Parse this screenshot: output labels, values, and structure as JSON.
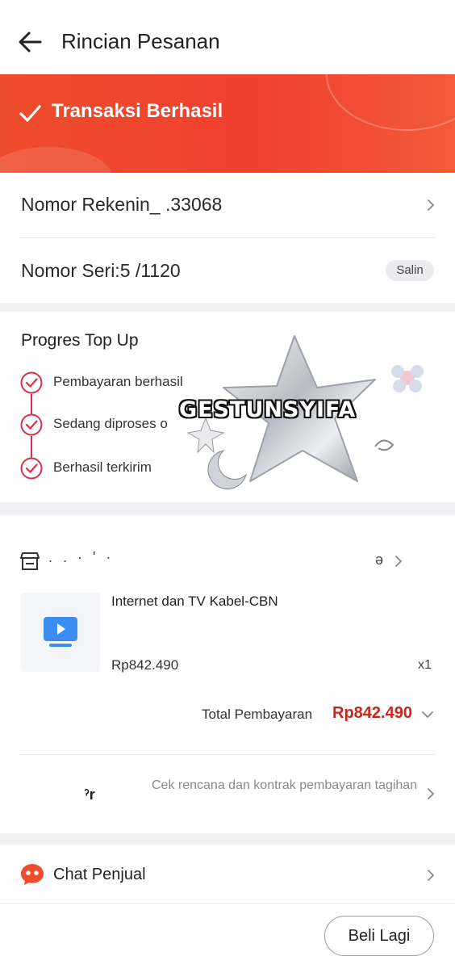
{
  "header": {
    "title": "Rincian Pesanan"
  },
  "banner": {
    "status": "Transaksi Berhasil"
  },
  "account": {
    "label": "Nomor Rekenin_ .33068"
  },
  "serial": {
    "label": "Nomor Seri:5 /1120",
    "copy_label": "Salin"
  },
  "progress": {
    "title": "Progres Top Up",
    "steps": [
      {
        "label": "Pembayaran berhasil"
      },
      {
        "label": "Sedang diproses o"
      },
      {
        "label": "Berhasil terkirim"
      }
    ]
  },
  "sticker": {
    "text": "GESTUNSYIFA"
  },
  "store": {
    "name": ". . · ' ·",
    "suffix": "ə"
  },
  "product": {
    "name": "Internet dan TV Kabel-CBN",
    "price": "Rp842.490",
    "quantity": "x1"
  },
  "total": {
    "label": "Total Pembayaran",
    "value": "Rp842.490"
  },
  "plan": {
    "logo_text": "ˀr",
    "text": "Cek rencana dan kontrak pembayaran tagihan"
  },
  "chat": {
    "label": "Chat Penjual"
  },
  "footer": {
    "buy_again_label": "Beli Lagi"
  },
  "colors": {
    "accent": "#ee4d2d",
    "price": "#c8271e",
    "step": "#d8304a"
  },
  "icons": [
    "arrow-left-icon",
    "check-icon",
    "chevron-right-icon",
    "check-circle-icon",
    "store-icon",
    "tv-play-icon",
    "chevron-down-icon",
    "chat-bubble-icon"
  ]
}
